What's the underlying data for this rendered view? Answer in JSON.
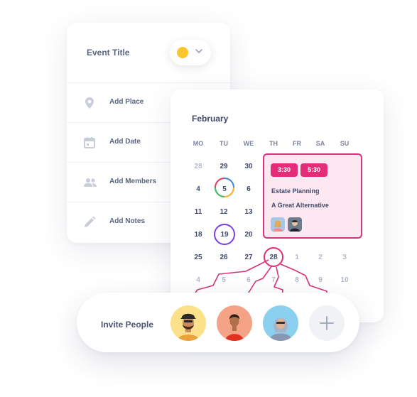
{
  "event_form": {
    "title_label": "Event Title",
    "color": "#fcc72c",
    "rows": [
      {
        "label": "Add Place",
        "icon": "location-pin-icon"
      },
      {
        "label": "Add Date",
        "icon": "calendar-icon"
      },
      {
        "label": "Add Members",
        "icon": "people-icon"
      },
      {
        "label": "Add Notes",
        "icon": "pencil-icon"
      }
    ]
  },
  "calendar": {
    "month": "February",
    "weekdays": [
      "MO",
      "TU",
      "WE",
      "TH",
      "FR",
      "SA",
      "SU"
    ],
    "weeks": [
      [
        "28",
        "29",
        "30",
        "",
        "",
        "",
        ""
      ],
      [
        "4",
        "5",
        "6",
        "",
        "",
        "",
        ""
      ],
      [
        "11",
        "12",
        "13",
        "",
        "",
        "",
        ""
      ],
      [
        "18",
        "19",
        "20",
        "",
        "",
        "",
        ""
      ],
      [
        "25",
        "26",
        "27",
        "28",
        "1",
        "2",
        "3"
      ],
      [
        "4",
        "5",
        "6",
        "7",
        "8",
        "9",
        "10"
      ]
    ],
    "event": {
      "times": [
        "3:30",
        "5:30"
      ],
      "title": "Estate Planning",
      "subtitle": "A Great Alternative"
    },
    "accent": "#e42d78",
    "ring_purple": "#7b3fe4"
  },
  "invite": {
    "label": "Invite People",
    "avatars": [
      {
        "name": "avatar-1",
        "bg": "#fde08a"
      },
      {
        "name": "avatar-2",
        "bg": "#f4a386"
      },
      {
        "name": "avatar-3",
        "bg": "#8cd0ef"
      }
    ]
  }
}
